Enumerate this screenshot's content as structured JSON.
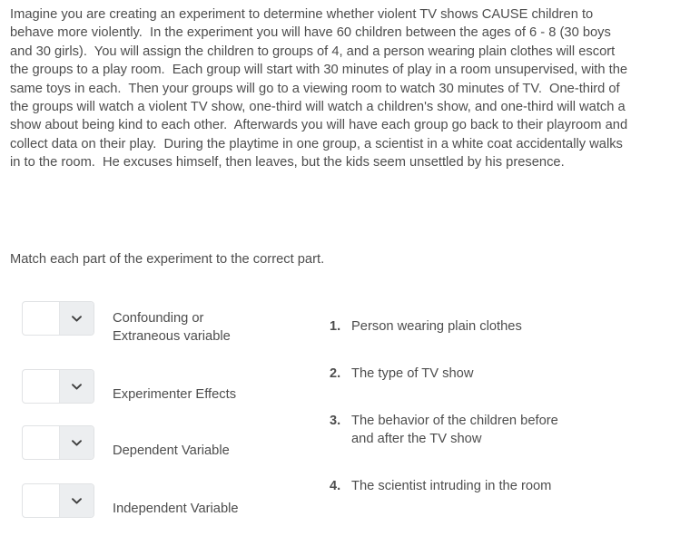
{
  "scenario": {
    "paragraph": "Imagine you are creating an experiment to determine whether violent TV shows CAUSE children to behave more violently.  In the experiment you will have 60 children between the ages of 6 - 8 (30 boys and 30 girls).  You will assign the children to groups of 4, and a person wearing plain clothes will escort the groups to a play room.  Each group will start with 30 minutes of play in a room unsupervised, with the same toys in each.  Then your groups will go to a viewing room to watch 30 minutes of TV.  One-third of the groups will watch a violent TV show, one-third will watch a children's show, and one-third will watch a show about being kind to each other.  Afterwards you will have each group go back to their playroom and collect data on their play.  During the playtime in one group, a scientist in a white coat accidentally walks in to the room.  He excuses himself, then leaves, but the kids seem unsettled by his presence."
  },
  "instruction": {
    "text": "Match each part of the experiment to the correct part."
  },
  "matching": {
    "dropdown_placeholder": "",
    "terms": [
      {
        "label": "Confounding or\nExtraneous variable",
        "selected": ""
      },
      {
        "label": "Experimenter Effects",
        "selected": ""
      },
      {
        "label": "Dependent Variable",
        "selected": ""
      },
      {
        "label": "Independent Variable",
        "selected": ""
      }
    ],
    "options": [
      {
        "number": "1.",
        "text": "Person wearing plain clothes"
      },
      {
        "number": "2.",
        "text": "The type of TV show"
      },
      {
        "number": "3.",
        "text": "The behavior of the children before\nand after the TV show"
      },
      {
        "number": "4.",
        "text": "The scientist intruding in the room"
      }
    ]
  },
  "icons": {
    "chevron_down": "chevron-down-icon"
  },
  "colors": {
    "text": "#4d4d4d",
    "background": "#ffffff",
    "select_border": "#e0e2e4",
    "select_button": "#eceef0",
    "chevron": "#3f3f3f"
  }
}
